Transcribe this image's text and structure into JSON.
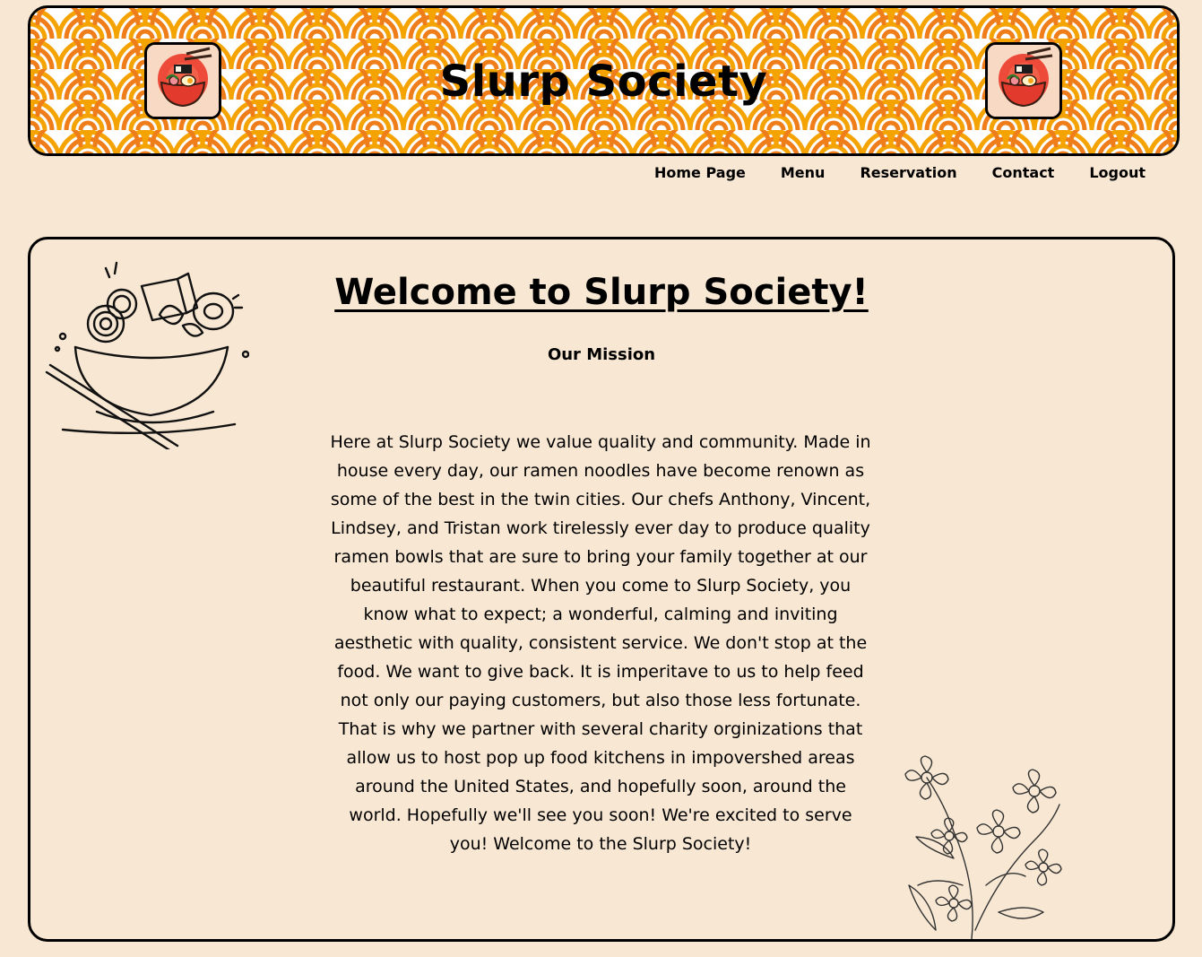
{
  "header": {
    "title": "Slurp Society",
    "pattern_colors": [
      "#f5a300",
      "#ef7d1a",
      "#ffffff"
    ],
    "logo_icon": "ramen-bowl-logo-icon"
  },
  "nav": {
    "items": [
      {
        "label": "Home Page"
      },
      {
        "label": "Menu"
      },
      {
        "label": "Reservation"
      },
      {
        "label": "Contact"
      },
      {
        "label": "Logout"
      }
    ]
  },
  "main": {
    "welcome_title": "Welcome to Slurp Society!",
    "mission_heading": "Our Mission",
    "mission_text": "Here at Slurp Society we value quality and community. Made in house every day, our ramen noodles have become renown as some of the best in the twin cities. Our chefs Anthony, Vincent, Lindsey, and Tristan work tirelessly ever day to produce quality ramen bowls that are sure to bring your family together at our beautiful restaurant. When you come to Slurp Society, you know what to expect; a wonderful, calming and inviting aesthetic with quality, consistent service. We don't stop at the food. We want to give back. It is imperitave to us to help feed not only our paying customers, but also those less fortunate. That is why we partner with several charity orginizations that allow us to host pop up food kitchens in impovershed areas around the United States, and hopefully soon, around the world. Hopefully we'll see you soon! We're excited to serve you! Welcome to the Slurp Society!",
    "bowl_illustration": "ramen-bowl-sketch-icon",
    "flower_illustration": "flower-sketch-icon"
  },
  "colors": {
    "background": "#f8e7d2",
    "border": "#000000",
    "pattern_yellow": "#f5a300",
    "pattern_orange": "#ef7d1a"
  }
}
